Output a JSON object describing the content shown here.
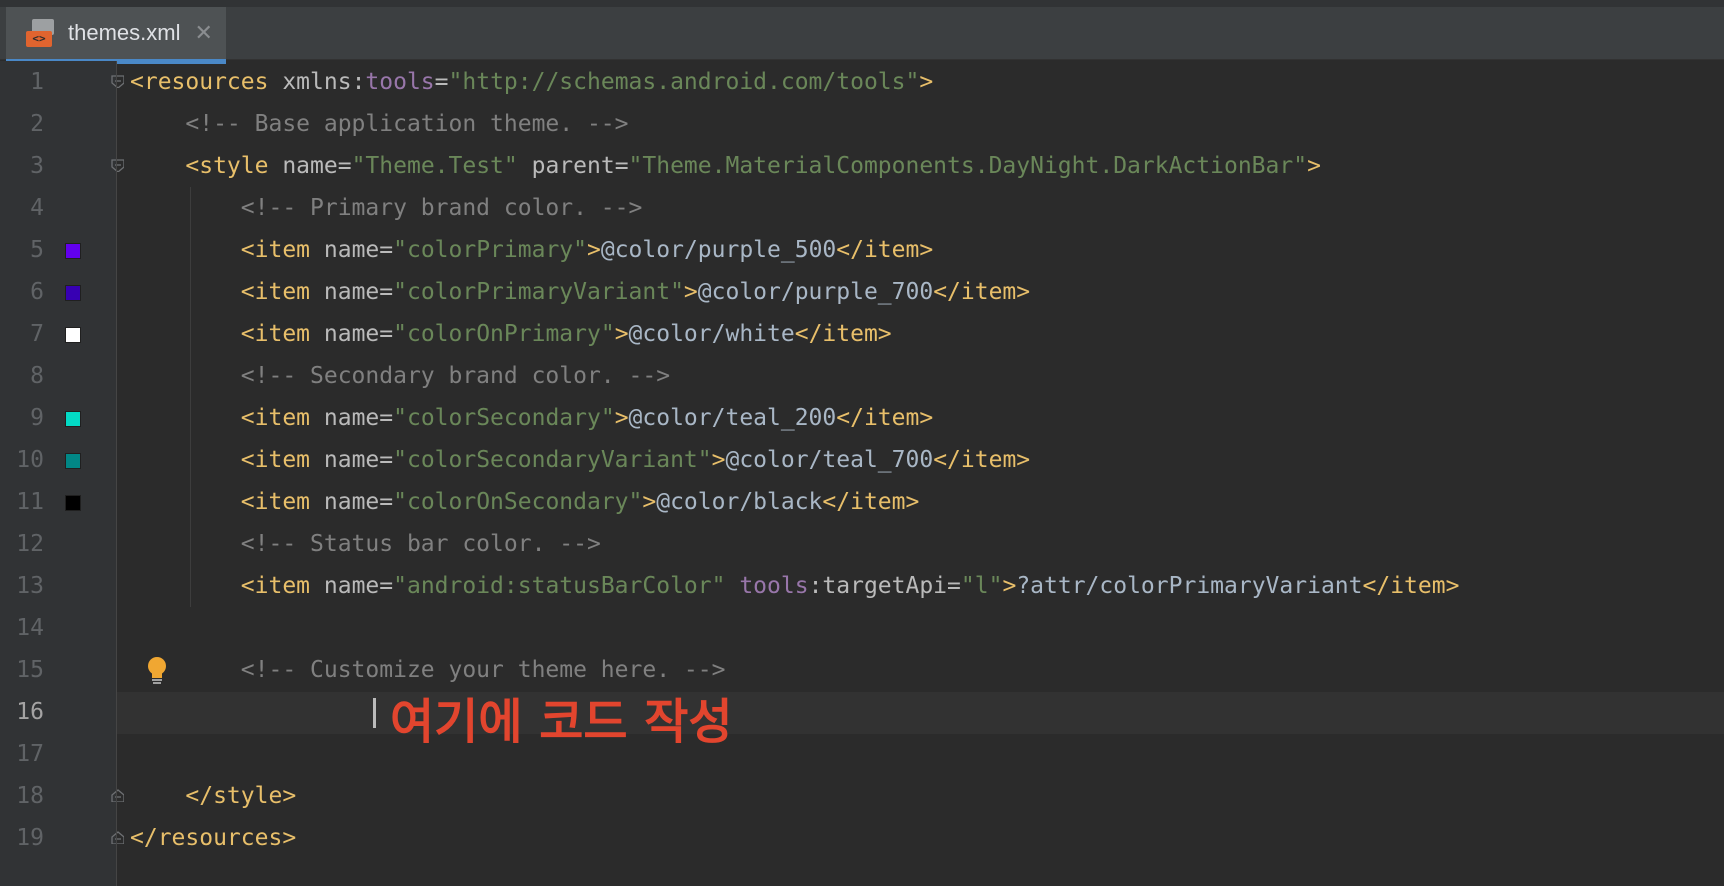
{
  "tab": {
    "file_name": "themes.xml",
    "icon_badge": "<>",
    "close_glyph": "✕"
  },
  "editor": {
    "current_line": 16,
    "annotation_text": "여기에 코드 작성",
    "line_numbers": [
      "1",
      "2",
      "3",
      "4",
      "5",
      "6",
      "7",
      "8",
      "9",
      "10",
      "11",
      "12",
      "13",
      "14",
      "15",
      "16",
      "17",
      "18",
      "19"
    ],
    "color_swatches": [
      {
        "line": 5,
        "color": "#6200ee"
      },
      {
        "line": 6,
        "color": "#3700b3"
      },
      {
        "line": 7,
        "color": "#ffffff"
      },
      {
        "line": 9,
        "color": "#03dac5"
      },
      {
        "line": 10,
        "color": "#018786"
      },
      {
        "line": 11,
        "color": "#000000"
      }
    ],
    "lines": [
      [
        [
          "tg",
          "<resources "
        ],
        [
          "an",
          "xmlns:"
        ],
        [
          "ns",
          "tools"
        ],
        [
          "an",
          "="
        ],
        [
          "av",
          "\"http://schemas.android.com/tools\""
        ],
        [
          "tg",
          ">"
        ]
      ],
      [
        [
          "cm",
          "    <!-- Base application theme. -->"
        ]
      ],
      [
        [
          "tg",
          "    <style "
        ],
        [
          "an",
          "name"
        ],
        [
          "an",
          "="
        ],
        [
          "av",
          "\"Theme.Test\" "
        ],
        [
          "an",
          "parent"
        ],
        [
          "an",
          "="
        ],
        [
          "av",
          "\"Theme.MaterialComponents.DayNight.DarkActionBar\""
        ],
        [
          "tg",
          ">"
        ]
      ],
      [
        [
          "cm",
          "        <!-- Primary brand color. -->"
        ]
      ],
      [
        [
          "tg",
          "        <item "
        ],
        [
          "an",
          "name"
        ],
        [
          "an",
          "="
        ],
        [
          "av",
          "\"colorPrimary\""
        ],
        [
          "tg",
          ">"
        ],
        [
          "tx",
          "@color/purple_500"
        ],
        [
          "tg",
          "</item>"
        ]
      ],
      [
        [
          "tg",
          "        <item "
        ],
        [
          "an",
          "name"
        ],
        [
          "an",
          "="
        ],
        [
          "av",
          "\"colorPrimaryVariant\""
        ],
        [
          "tg",
          ">"
        ],
        [
          "tx",
          "@color/purple_700"
        ],
        [
          "tg",
          "</item>"
        ]
      ],
      [
        [
          "tg",
          "        <item "
        ],
        [
          "an",
          "name"
        ],
        [
          "an",
          "="
        ],
        [
          "av",
          "\"colorOnPrimary\""
        ],
        [
          "tg",
          ">"
        ],
        [
          "tx",
          "@color/white"
        ],
        [
          "tg",
          "</item>"
        ]
      ],
      [
        [
          "cm",
          "        <!-- Secondary brand color. -->"
        ]
      ],
      [
        [
          "tg",
          "        <item "
        ],
        [
          "an",
          "name"
        ],
        [
          "an",
          "="
        ],
        [
          "av",
          "\"colorSecondary\""
        ],
        [
          "tg",
          ">"
        ],
        [
          "tx",
          "@color/teal_200"
        ],
        [
          "tg",
          "</item>"
        ]
      ],
      [
        [
          "tg",
          "        <item "
        ],
        [
          "an",
          "name"
        ],
        [
          "an",
          "="
        ],
        [
          "av",
          "\"colorSecondaryVariant\""
        ],
        [
          "tg",
          ">"
        ],
        [
          "tx",
          "@color/teal_700"
        ],
        [
          "tg",
          "</item>"
        ]
      ],
      [
        [
          "tg",
          "        <item "
        ],
        [
          "an",
          "name"
        ],
        [
          "an",
          "="
        ],
        [
          "av",
          "\"colorOnSecondary\""
        ],
        [
          "tg",
          ">"
        ],
        [
          "tx",
          "@color/black"
        ],
        [
          "tg",
          "</item>"
        ]
      ],
      [
        [
          "cm",
          "        <!-- Status bar color. -->"
        ]
      ],
      [
        [
          "tg",
          "        <item "
        ],
        [
          "an",
          "name"
        ],
        [
          "an",
          "="
        ],
        [
          "av",
          "\"android:statusBarColor\" "
        ],
        [
          "ns",
          "tools"
        ],
        [
          "an",
          ":targetApi"
        ],
        [
          "an",
          "="
        ],
        [
          "av",
          "\"l\""
        ],
        [
          "tg",
          ">"
        ],
        [
          "tx",
          "?attr/colorPrimaryVariant"
        ],
        [
          "tg",
          "</item>"
        ]
      ],
      [],
      [
        [
          "cm",
          "        <!-- Customize your theme here. -->"
        ]
      ],
      [],
      [],
      [
        [
          "tg",
          "    </style>"
        ]
      ],
      [
        [
          "tg",
          "</resources>"
        ]
      ]
    ]
  }
}
